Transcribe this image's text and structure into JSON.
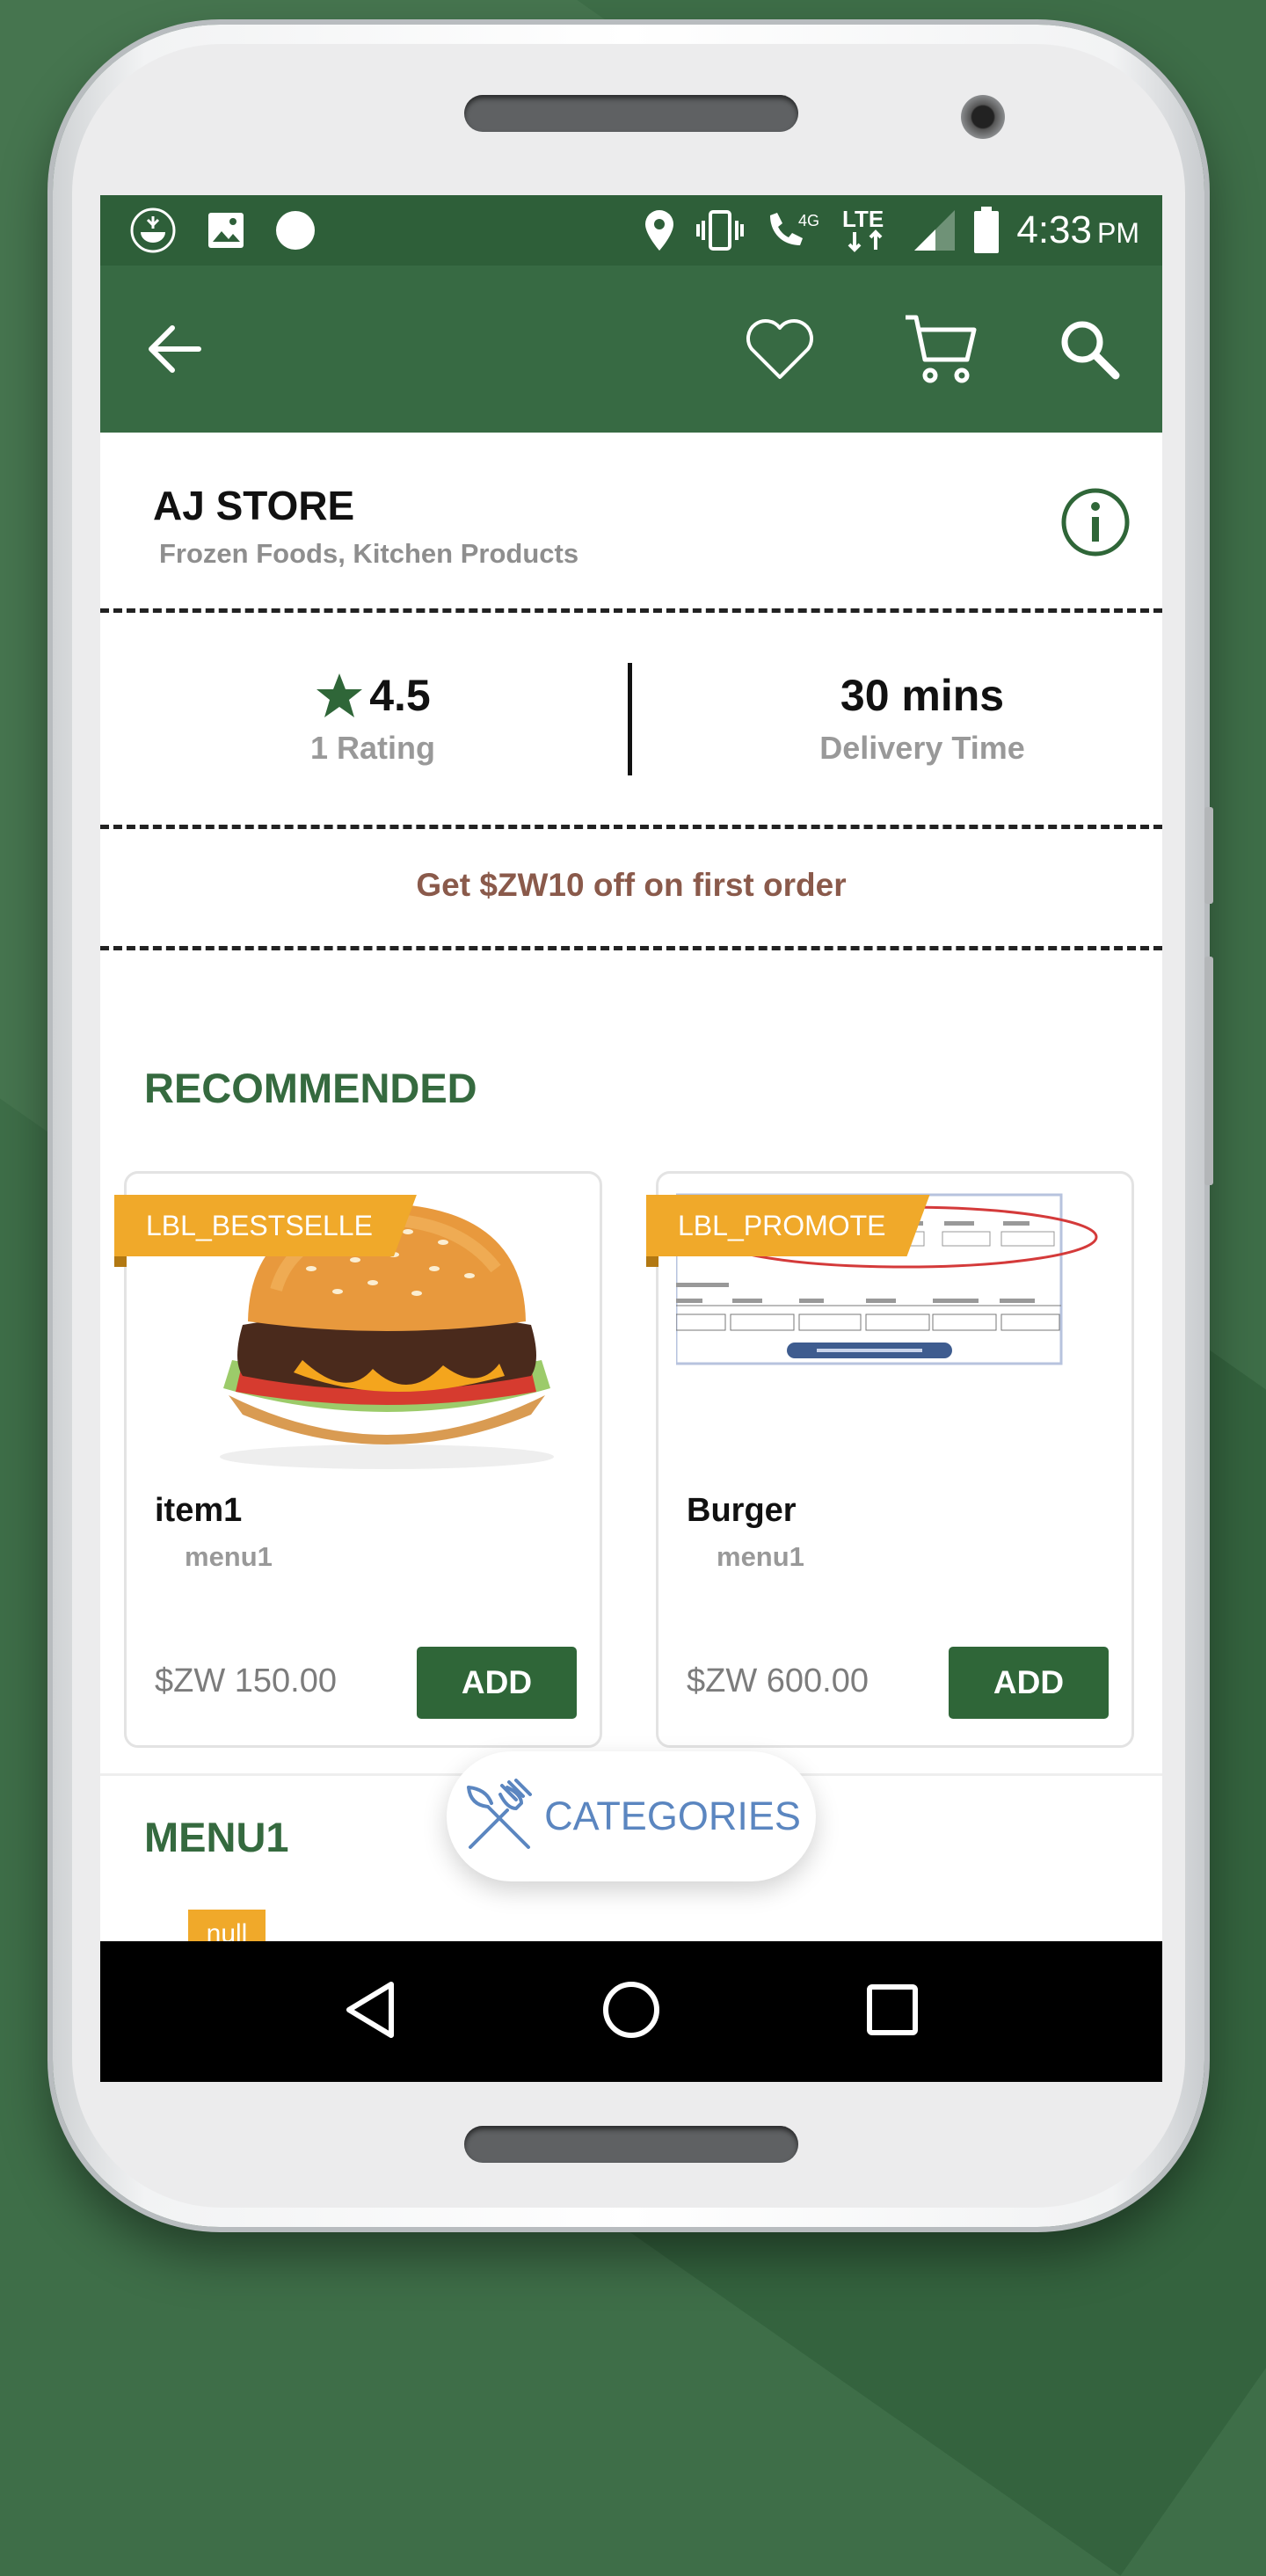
{
  "status_bar": {
    "time": "4:33",
    "ampm": "PM",
    "network": "4G",
    "lte": "LTE"
  },
  "app_bar": {
    "back_icon": "arrow-back-icon",
    "favorite_icon": "heart-icon",
    "cart_icon": "cart-icon",
    "search_icon": "search-icon"
  },
  "store": {
    "name": "AJ STORE",
    "categories": "Frozen Foods, Kitchen Products",
    "rating_value": "4.5",
    "rating_label": "1 Rating",
    "delivery_value": "30 mins",
    "delivery_label": "Delivery Time",
    "offer": "Get $ZW10 off on first order"
  },
  "sections": {
    "recommended": "RECOMMENDED",
    "menu1": "MENU1"
  },
  "items": [
    {
      "badge": "LBL_BESTSELLE",
      "name": "item1",
      "menu": "menu1",
      "price": "$ZW 150.00",
      "button": "ADD"
    },
    {
      "badge": "LBL_PROMOTE",
      "name": "Burger",
      "menu": "menu1",
      "price": "$ZW 600.00",
      "button": "ADD"
    }
  ],
  "categories_button": "CATEGORIES",
  "next_item_badge": "null",
  "colors": {
    "primary": "#376a43",
    "status": "#2e5f39",
    "badge": "#f0a92a",
    "offer_text": "#8a5a4b",
    "categories_text": "#5b86c0"
  }
}
